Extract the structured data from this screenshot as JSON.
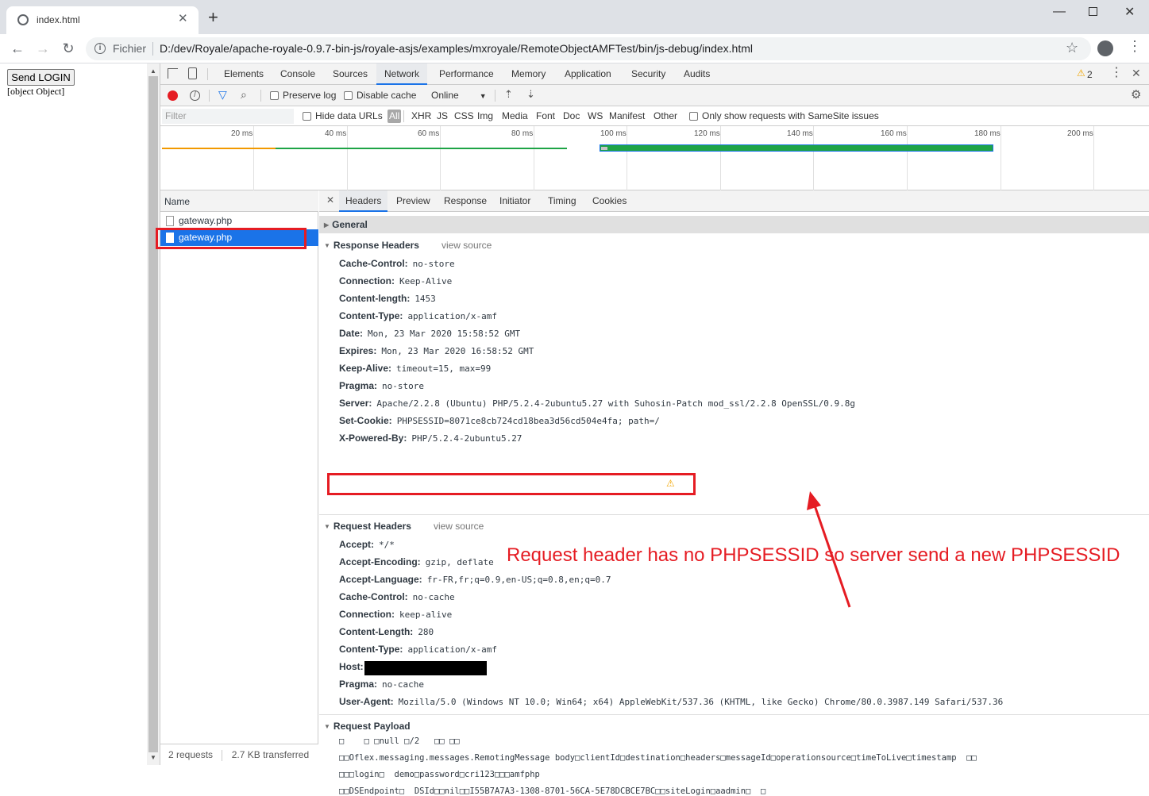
{
  "browser": {
    "tab_title": "index.html",
    "new_tab": "+",
    "url_scheme": "Fichier",
    "url": "D:/dev/Royale/apache-royale-0.9.7-bin-js/royale-asjs/examples/mxroyale/RemoteObjectAMFTest/bin/js-debug/index.html"
  },
  "page": {
    "button_label": "Send LOGIN",
    "output_text": "[object Object]"
  },
  "devtools": {
    "tabs": [
      "Elements",
      "Console",
      "Sources",
      "Network",
      "Performance",
      "Memory",
      "Application",
      "Security",
      "Audits"
    ],
    "selected_tab": "Network",
    "warning_count": "2",
    "toolbar": {
      "preserve_log": "Preserve log",
      "disable_cache": "Disable cache",
      "throttle": "Online"
    },
    "filter_bar": {
      "placeholder": "Filter",
      "hide_data_urls": "Hide data URLs",
      "types": [
        "All",
        "XHR",
        "JS",
        "CSS",
        "Img",
        "Media",
        "Font",
        "Doc",
        "WS",
        "Manifest",
        "Other"
      ],
      "samesite": "Only show requests with SameSite issues"
    },
    "timeline_ticks": [
      "20 ms",
      "40 ms",
      "60 ms",
      "80 ms",
      "100 ms",
      "120 ms",
      "140 ms",
      "160 ms",
      "180 ms",
      "200 ms"
    ],
    "request_list": {
      "header": "Name",
      "items": [
        "gateway.php",
        "gateway.php"
      ],
      "status_requests": "2 requests",
      "status_transferred": "2.7 KB transferred"
    },
    "detail_tabs": [
      "Headers",
      "Preview",
      "Response",
      "Initiator",
      "Timing",
      "Cookies"
    ],
    "general_label": "General",
    "response_headers": {
      "title": "Response Headers",
      "view_source": "view source",
      "rows": [
        {
          "k": "Cache-Control:",
          "v": "no-store"
        },
        {
          "k": "Connection:",
          "v": "Keep-Alive"
        },
        {
          "k": "Content-length:",
          "v": "1453"
        },
        {
          "k": "Content-Type:",
          "v": "application/x-amf"
        },
        {
          "k": "Date:",
          "v": "Mon, 23 Mar 2020 15:58:52 GMT"
        },
        {
          "k": "Expires:",
          "v": "Mon, 23 Mar 2020 16:58:52 GMT"
        },
        {
          "k": "Keep-Alive:",
          "v": "timeout=15, max=99"
        },
        {
          "k": "Pragma:",
          "v": "no-store"
        },
        {
          "k": "Server:",
          "v": "Apache/2.2.8 (Ubuntu) PHP/5.2.4-2ubuntu5.27 with Suhosin-Patch mod_ssl/2.2.8 OpenSSL/0.9.8g"
        },
        {
          "k": "Set-Cookie:",
          "v": "PHPSESSID=8071ce8cb724cd18bea3d56cd504e4fa; path=/"
        },
        {
          "k": "X-Powered-By:",
          "v": "PHP/5.2.4-2ubuntu5.27"
        }
      ]
    },
    "request_headers": {
      "title": "Request Headers",
      "view_source": "view source",
      "rows": [
        {
          "k": "Accept:",
          "v": "*/*"
        },
        {
          "k": "Accept-Encoding:",
          "v": "gzip, deflate"
        },
        {
          "k": "Accept-Language:",
          "v": "fr-FR,fr;q=0.9,en-US;q=0.8,en;q=0.7"
        },
        {
          "k": "Cache-Control:",
          "v": "no-cache"
        },
        {
          "k": "Connection:",
          "v": "keep-alive"
        },
        {
          "k": "Content-Length:",
          "v": "280"
        },
        {
          "k": "Content-Type:",
          "v": "application/x-amf"
        },
        {
          "k": "Host:",
          "v": ""
        },
        {
          "k": "Pragma:",
          "v": "no-cache"
        },
        {
          "k": "User-Agent:",
          "v": "Mozilla/5.0 (Windows NT 10.0; Win64; x64) AppleWebKit/537.36 (KHTML, like Gecko) Chrome/80.0.3987.149 Safari/537.36"
        }
      ]
    },
    "request_payload": {
      "title": "Request Payload",
      "lines": [
        "□    □ □null □/2   □□ □□",
        "□□Oflex.messaging.messages.RemotingMessage body□clientId□destination□headers□messageId□operationsource□timeToLive□timestamp  □□",
        "□□□login□  demo□password□cri123□□□amfphp",
        "□□DSEndpoint□  DSId□□nil□□I55B7A7A3-1308-8701-56CA-5E78DCBCE7BC□□siteLogin□aadmin□  □"
      ]
    }
  },
  "annotation": {
    "text": "Request header has no PHPSESSID so server send a new PHPSESSID",
    "color": "#e51c23"
  }
}
